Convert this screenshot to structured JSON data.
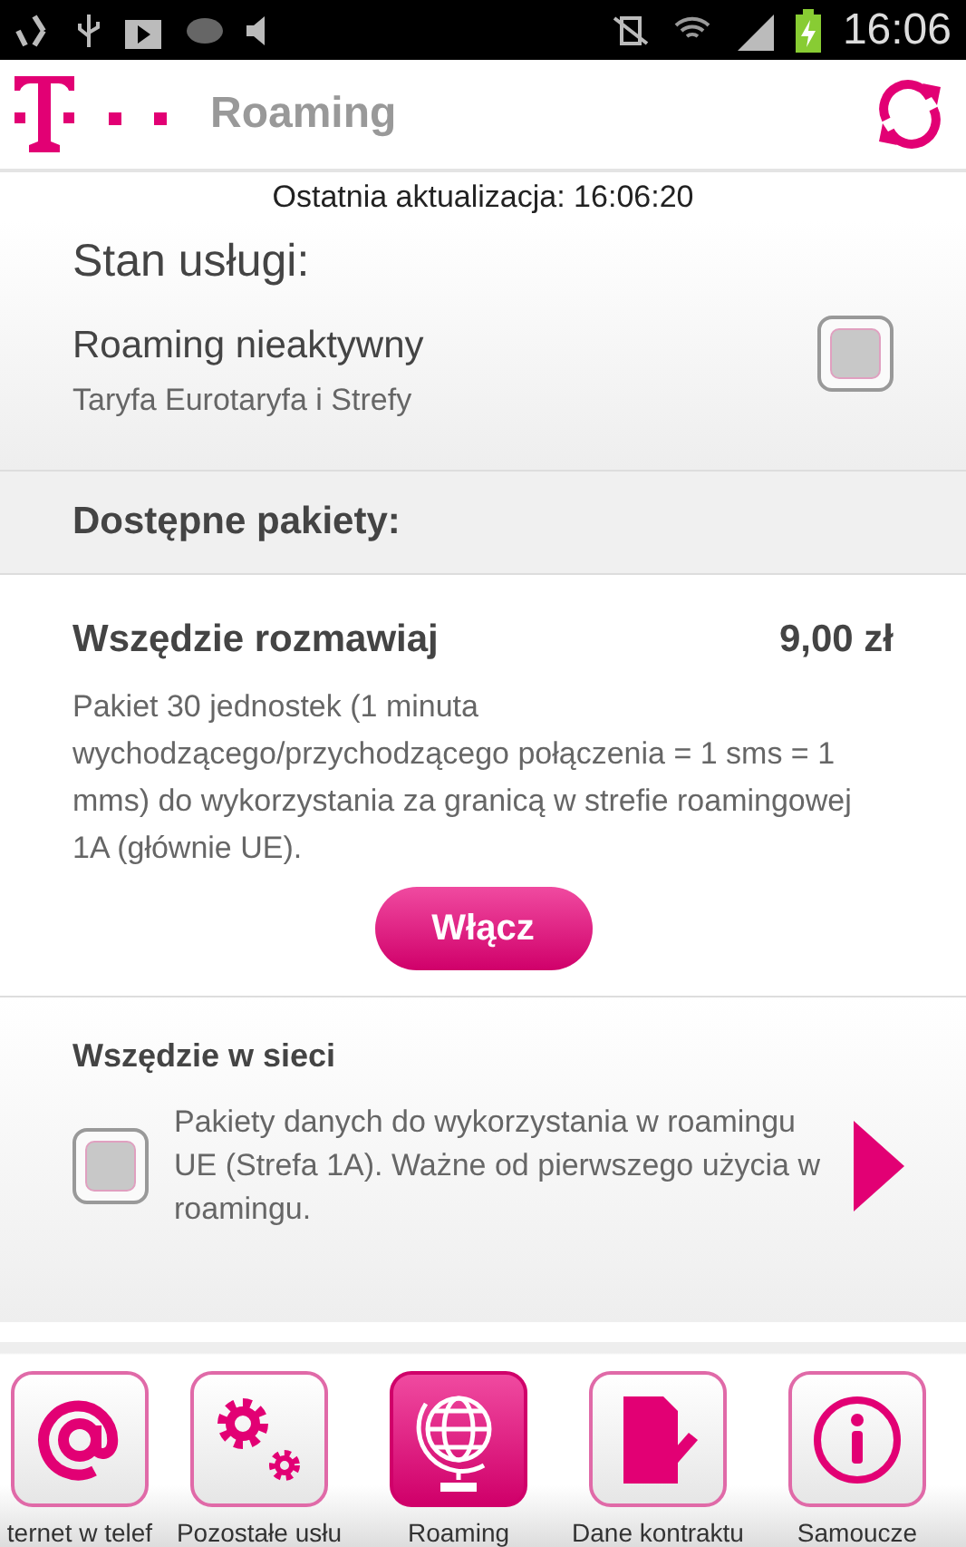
{
  "status_bar": {
    "time": "16:06"
  },
  "header": {
    "title": "Roaming"
  },
  "last_update": "Ostatnia aktualizacja: 16:06:20",
  "service": {
    "heading": "Stan usługi:",
    "status": "Roaming nieaktywny",
    "tariff": "Taryfa Eurotaryfa i Strefy",
    "checked": false
  },
  "packages_heading": "Dostępne pakiety:",
  "packages": [
    {
      "kind": "button",
      "name": "Wszędzie rozmawiaj",
      "price": "9,00 zł",
      "description": "Pakiet 30 jednostek (1 minuta wychodzącego/przychodzącego połączenia = 1 sms = 1 mms) do wykorzystania za granicą w strefie roamingowej 1A (głównie UE).",
      "button": "Włącz"
    },
    {
      "kind": "checkbox",
      "name": "Wszędzie w sieci",
      "description": "Pakiety danych do wykorzystania w roamingu UE (Strefa 1A). Ważne od pierwszego użycia w roamingu.",
      "checked": false
    }
  ],
  "nav": [
    {
      "kind": "at",
      "label": "ternet w telef",
      "selected": false
    },
    {
      "kind": "gears",
      "label": "Pozostałe usłu",
      "selected": false
    },
    {
      "kind": "globe",
      "label": "Roaming",
      "selected": true
    },
    {
      "kind": "document",
      "label": "Dane kontraktu",
      "selected": false
    },
    {
      "kind": "info",
      "label": "Samoucze",
      "selected": false
    }
  ]
}
